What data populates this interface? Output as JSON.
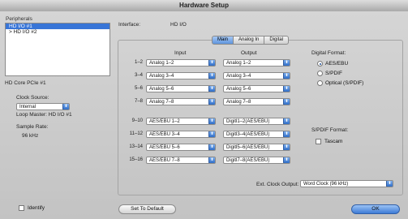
{
  "window": {
    "title": "Hardware Setup"
  },
  "peripherals": {
    "label": "Peripherals",
    "items": [
      {
        "label": "HD I/O #1",
        "selected": true
      },
      {
        "label": "> HD I/O #2",
        "selected": false
      }
    ]
  },
  "core": {
    "title": "HD Core PCIe #1",
    "clock_source_label": "Clock Source:",
    "clock_source_value": "Internal",
    "loop_master": "Loop Master: HD I/O #1",
    "sample_rate_label": "Sample Rate:",
    "sample_rate_value": "96 kHz"
  },
  "identify": {
    "label": "Identify",
    "checked": false
  },
  "interface": {
    "label": "Interface:",
    "value": "HD I/O"
  },
  "tabs": [
    "Main",
    "Analog In",
    "Digital"
  ],
  "active_tab": "Main",
  "columns": {
    "input": "Input",
    "output": "Output"
  },
  "rows": [
    {
      "label": "1–2",
      "input": "Analog 1–2",
      "output": "Analog 1–2"
    },
    {
      "label": "3–4",
      "input": "Analog 3–4",
      "output": "Analog 3–4"
    },
    {
      "label": "5–6",
      "input": "Analog 5–6",
      "output": "Analog 5–6"
    },
    {
      "label": "7–8",
      "input": "Analog 7–8",
      "output": "Analog 7–8"
    },
    {
      "label": "9–10",
      "input": "AES/EBU 1–2",
      "output": "Digitl1–2(AES/EBU)"
    },
    {
      "label": "11–12",
      "input": "AES/EBU 3–4",
      "output": "Digitl3–4(AES/EBU)"
    },
    {
      "label": "13–14",
      "input": "AES/EBU 5–6",
      "output": "Digitl5–6(AES/EBU)"
    },
    {
      "label": "15–16",
      "input": "AES/EBU 7–8",
      "output": "Digitl7–8(AES/EBU)"
    }
  ],
  "digital_format": {
    "label": "Digital Format:",
    "options": [
      {
        "label": "AES/EBU",
        "selected": true
      },
      {
        "label": "S/PDIF",
        "selected": false
      },
      {
        "label": "Optical (S/PDIF)",
        "selected": false
      }
    ]
  },
  "spdif_format": {
    "label": "S/PDIF Format:",
    "tascam_label": "Tascam",
    "tascam_checked": false
  },
  "ext_clock": {
    "label": "Ext. Clock Output:",
    "value": "Word Clock (96 kHz)"
  },
  "buttons": {
    "set_default": "Set To Default",
    "ok": "OK"
  }
}
